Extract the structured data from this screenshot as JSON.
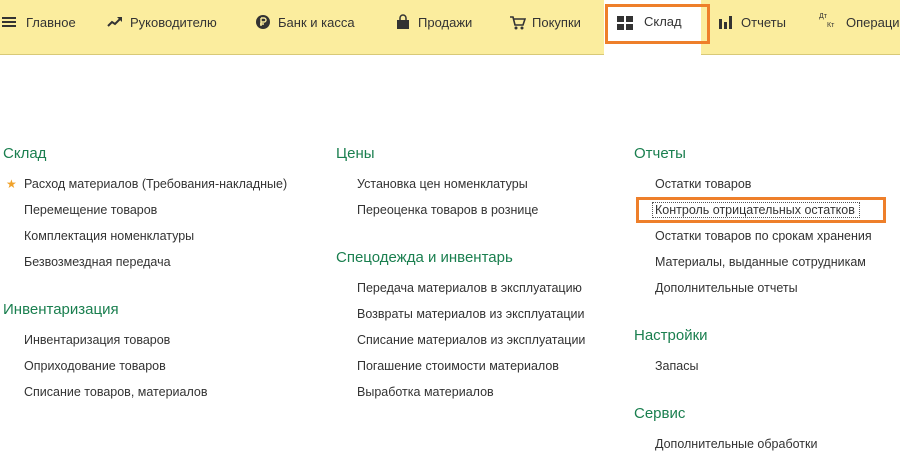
{
  "menu": {
    "tabs": [
      {
        "label": "Главное",
        "icon": "hamburger-icon"
      },
      {
        "label": "Руководителю",
        "icon": "trend-icon"
      },
      {
        "label": "Банк и касса",
        "icon": "ruble-icon"
      },
      {
        "label": "Продажи",
        "icon": "bag-icon"
      },
      {
        "label": "Покупки",
        "icon": "cart-icon"
      },
      {
        "label": "Склад",
        "icon": "warehouse-icon"
      },
      {
        "label": "Отчеты",
        "icon": "bar-chart-icon"
      },
      {
        "label": "Операци",
        "icon": "dt-kt-icon",
        "icon_text_top": "Дт",
        "icon_text_bottom": "Кт"
      }
    ],
    "active_tab": "Склад"
  },
  "sections": {
    "sklad": {
      "title": "Склад",
      "items": [
        "Расход материалов (Требования-накладные)",
        "Перемещение товаров",
        "Комплектация номенклатуры",
        "Безвозмездная передача"
      ]
    },
    "inventarizaciya": {
      "title": "Инвентаризация",
      "items": [
        "Инвентаризация товаров",
        "Оприходование товаров",
        "Списание товаров, материалов"
      ]
    },
    "ceny": {
      "title": "Цены",
      "items": [
        "Установка цен номенклатуры",
        "Переоценка товаров в рознице"
      ]
    },
    "specodezhda": {
      "title": "Спецодежда и инвентарь",
      "items": [
        "Передача материалов в эксплуатацию",
        "Возвраты материалов из эксплуатации",
        "Списание материалов из эксплуатации",
        "Погашение стоимости материалов",
        "Выработка материалов"
      ]
    },
    "otchety": {
      "title": "Отчеты",
      "items": [
        "Остатки товаров",
        "Контроль отрицательных остатков",
        "Остатки товаров по срокам хранения",
        "Материалы, выданные сотрудникам",
        "Дополнительные отчеты"
      ]
    },
    "nastroiki": {
      "title": "Настройки",
      "items": [
        "Запасы"
      ]
    },
    "servis": {
      "title": "Сервис",
      "items": [
        "Дополнительные обработки"
      ]
    }
  },
  "colors": {
    "menu_bg": "#fbed9e",
    "section_title": "#1a7f4f",
    "highlight": "#ee7f2a",
    "favorite_star": "#f0a22a"
  }
}
